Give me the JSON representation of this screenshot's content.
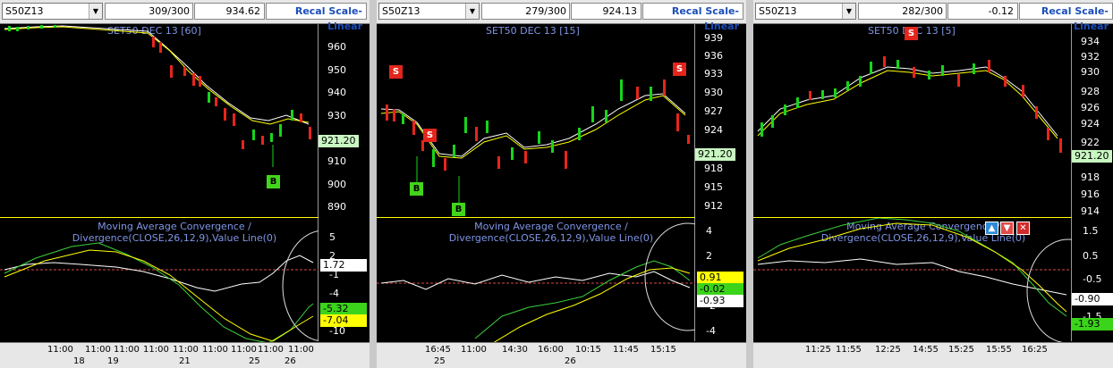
{
  "colors": {
    "up": "#17d51b",
    "down": "#e8251b",
    "ma1": "#ffffff",
    "ma2": "#ffff00",
    "macd": "#3ad13a",
    "signal": "#ffff00",
    "zero": "#d24b4b",
    "bg": "#000000"
  },
  "panels": [
    {
      "symbol": "S50Z13",
      "counter": "309/300",
      "last": "934.62",
      "recal": "Recal Scale-Linear",
      "title": "SET50 DEC 13  [60]",
      "price_ticks": [
        "960",
        "950",
        "940",
        "930",
        "921.20",
        "910",
        "900",
        "890"
      ],
      "price_tag": "921.20",
      "macd_title_l1": "Moving Average Convergence /",
      "macd_title_l2": "Divergence(CLOSE,26,12,9),Value Line(0)",
      "macd_ticks": [
        "5",
        "2",
        "-1",
        "-4",
        "-7",
        "-10"
      ],
      "macd_tags": [
        "1.72",
        "-5.32",
        "-7.04"
      ],
      "time_labels": [
        "11:00",
        "11:00",
        "11:00",
        "11:00",
        "11:00",
        "11:00",
        "11:00",
        "11:00",
        "11:00",
        "11:00",
        "11:00"
      ],
      "date_labels": [
        "18",
        "19",
        "21",
        "25",
        "26"
      ],
      "signals": [
        {
          "type": "B",
          "label": "B"
        }
      ]
    },
    {
      "symbol": "S50Z13",
      "counter": "279/300",
      "last": "924.13",
      "recal": "Recal Scale-Linear",
      "title": "SET50 DEC 13  [15]",
      "price_ticks": [
        "939",
        "936",
        "933",
        "930",
        "927",
        "924",
        "921.20",
        "918",
        "915",
        "912"
      ],
      "price_tag": "921.20",
      "macd_title_l1": "Moving Average Convergence /",
      "macd_title_l2": "Divergence(CLOSE,26,12,9),Value Line(0)",
      "macd_ticks": [
        "4",
        "2",
        "0",
        "-2",
        "-4"
      ],
      "macd_tags": [
        "0.91",
        "-0.02",
        "-0.93"
      ],
      "time_labels": [
        "16:45",
        "11:00",
        "14:30",
        "16:00",
        "10:15",
        "11:45",
        "15:15"
      ],
      "date_labels": [
        "25",
        "26"
      ],
      "signals": [
        {
          "type": "S",
          "label": "S"
        },
        {
          "type": "S",
          "label": "S"
        },
        {
          "type": "S",
          "label": "S"
        },
        {
          "type": "B",
          "label": "B"
        },
        {
          "type": "B",
          "label": "B"
        }
      ]
    },
    {
      "symbol": "S50Z13",
      "counter": "282/300",
      "last": "-0.12",
      "recal": "Recal Scale-Linear",
      "title": "SET50 DEC 13  [5]",
      "price_ticks": [
        "934",
        "932",
        "930",
        "928",
        "926",
        "924",
        "922",
        "921.20",
        "918",
        "916",
        "914"
      ],
      "price_tag": "921.20",
      "macd_title_l1": "Moving Average Convergence /",
      "macd_title_l2": "Divergence(CLOSE,26,12,9),Value Line(0)",
      "macd_ticks": [
        "1.5",
        "0.5",
        "-0.5",
        "-1.5"
      ],
      "macd_tags": [
        "-0.90",
        "-1.93"
      ],
      "time_labels": [
        "11:25",
        "11:55",
        "12:25",
        "14:55",
        "15:25",
        "15:55",
        "16:25"
      ],
      "date_labels": [],
      "signals": [
        {
          "type": "S",
          "label": "S"
        }
      ]
    }
  ],
  "chart_controls": {
    "up_icon": "up-arrow-icon",
    "down_icon": "down-arrow-icon",
    "close_icon": "close-icon"
  }
}
